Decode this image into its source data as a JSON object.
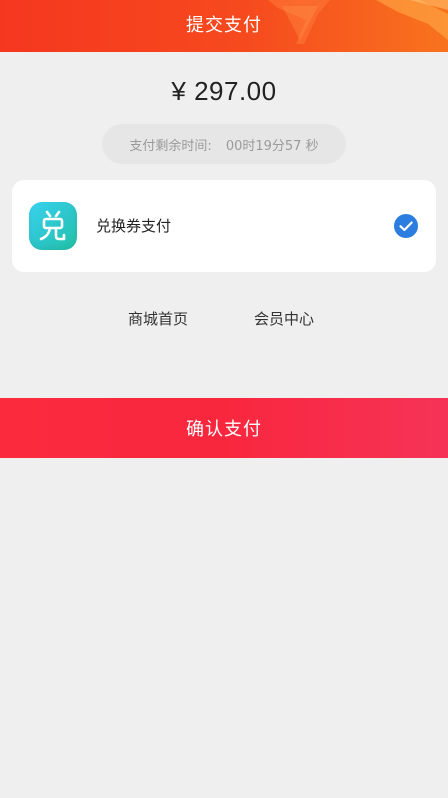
{
  "header": {
    "title": "提交支付",
    "gradient_colors": [
      "#f5371f",
      "#f8731e"
    ]
  },
  "payment": {
    "amount": "¥ 297.00",
    "countdown_label": "支付剩余时间:",
    "countdown_value": "00时19分57 秒"
  },
  "method": {
    "icon": "voucher-app-icon",
    "label": "兑换券支付",
    "selected": true,
    "check_color": "#2b7de0"
  },
  "links": {
    "home": "商城首页",
    "member": "会员中心"
  },
  "confirm": {
    "label": "确认支付",
    "color": "#fc2a3d"
  }
}
